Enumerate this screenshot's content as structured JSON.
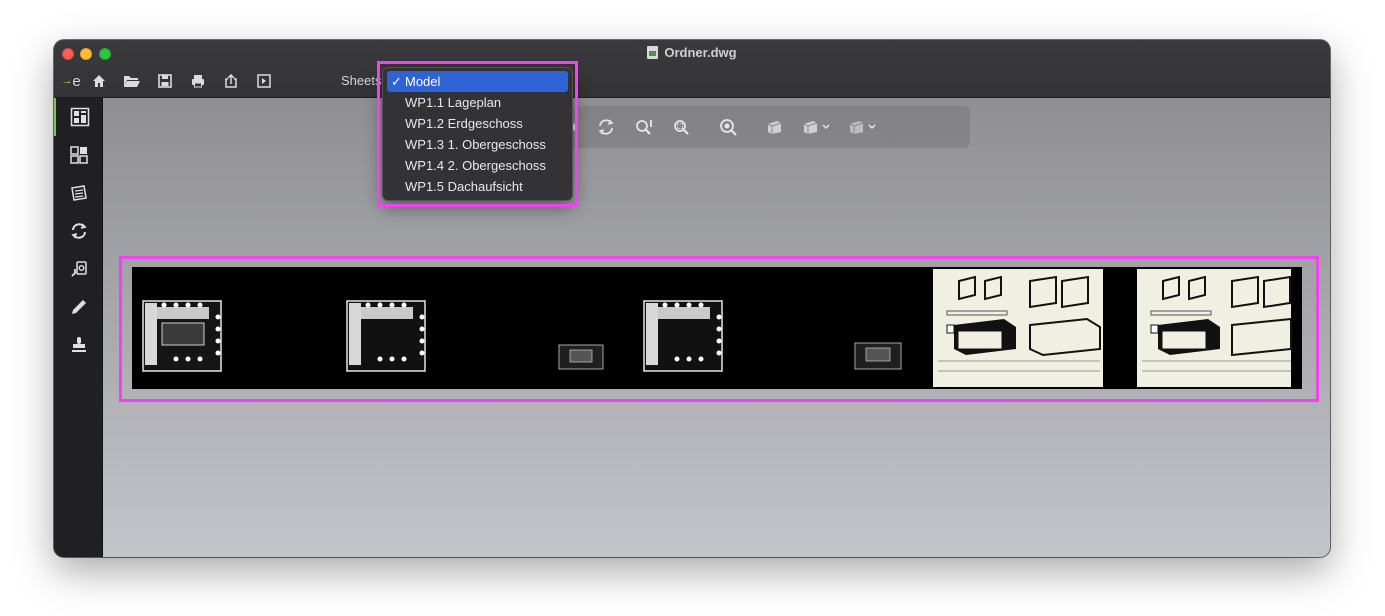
{
  "window": {
    "title": "Ordner.dwg"
  },
  "toolbar": {
    "icons": [
      "app-logo-icon",
      "home-icon",
      "open-folder-icon",
      "save-icon",
      "print-icon",
      "share-icon",
      "export-icon"
    ],
    "sheets_label": "Sheets:"
  },
  "sheet_dropdown": {
    "check_mark": "✓",
    "selected": "Model",
    "options": [
      {
        "label": "Model",
        "selected": true
      },
      {
        "label": "WP1.1 Lageplan",
        "selected": false
      },
      {
        "label": "WP1.2 Erdgeschoss",
        "selected": false
      },
      {
        "label": "WP1.3 1. Obergeschoss",
        "selected": false
      },
      {
        "label": "WP1.4 2. Obergeschoss",
        "selected": false
      },
      {
        "label": "WP1.5 Dachaufsicht",
        "selected": false
      }
    ]
  },
  "sidebar": {
    "items": [
      "model-view-icon",
      "layouts-icon",
      "layers-icon",
      "compare-icon",
      "search-icon",
      "pen-icon",
      "stamp-icon"
    ]
  },
  "view_toolbar": {
    "icons": [
      "pan-icon",
      "orbit-icon",
      "zoom-extents-icon",
      "zoom-window-icon",
      "zoom-realtime-icon",
      "view-cube-icon",
      "view-preset-icon",
      "visual-style-icon"
    ]
  },
  "colors": {
    "highlight": "#ee44ee",
    "selection": "#2f62d4",
    "accent": "#6fd050",
    "drawing_background": "#000000",
    "sheet_paper": "#efefe2"
  }
}
